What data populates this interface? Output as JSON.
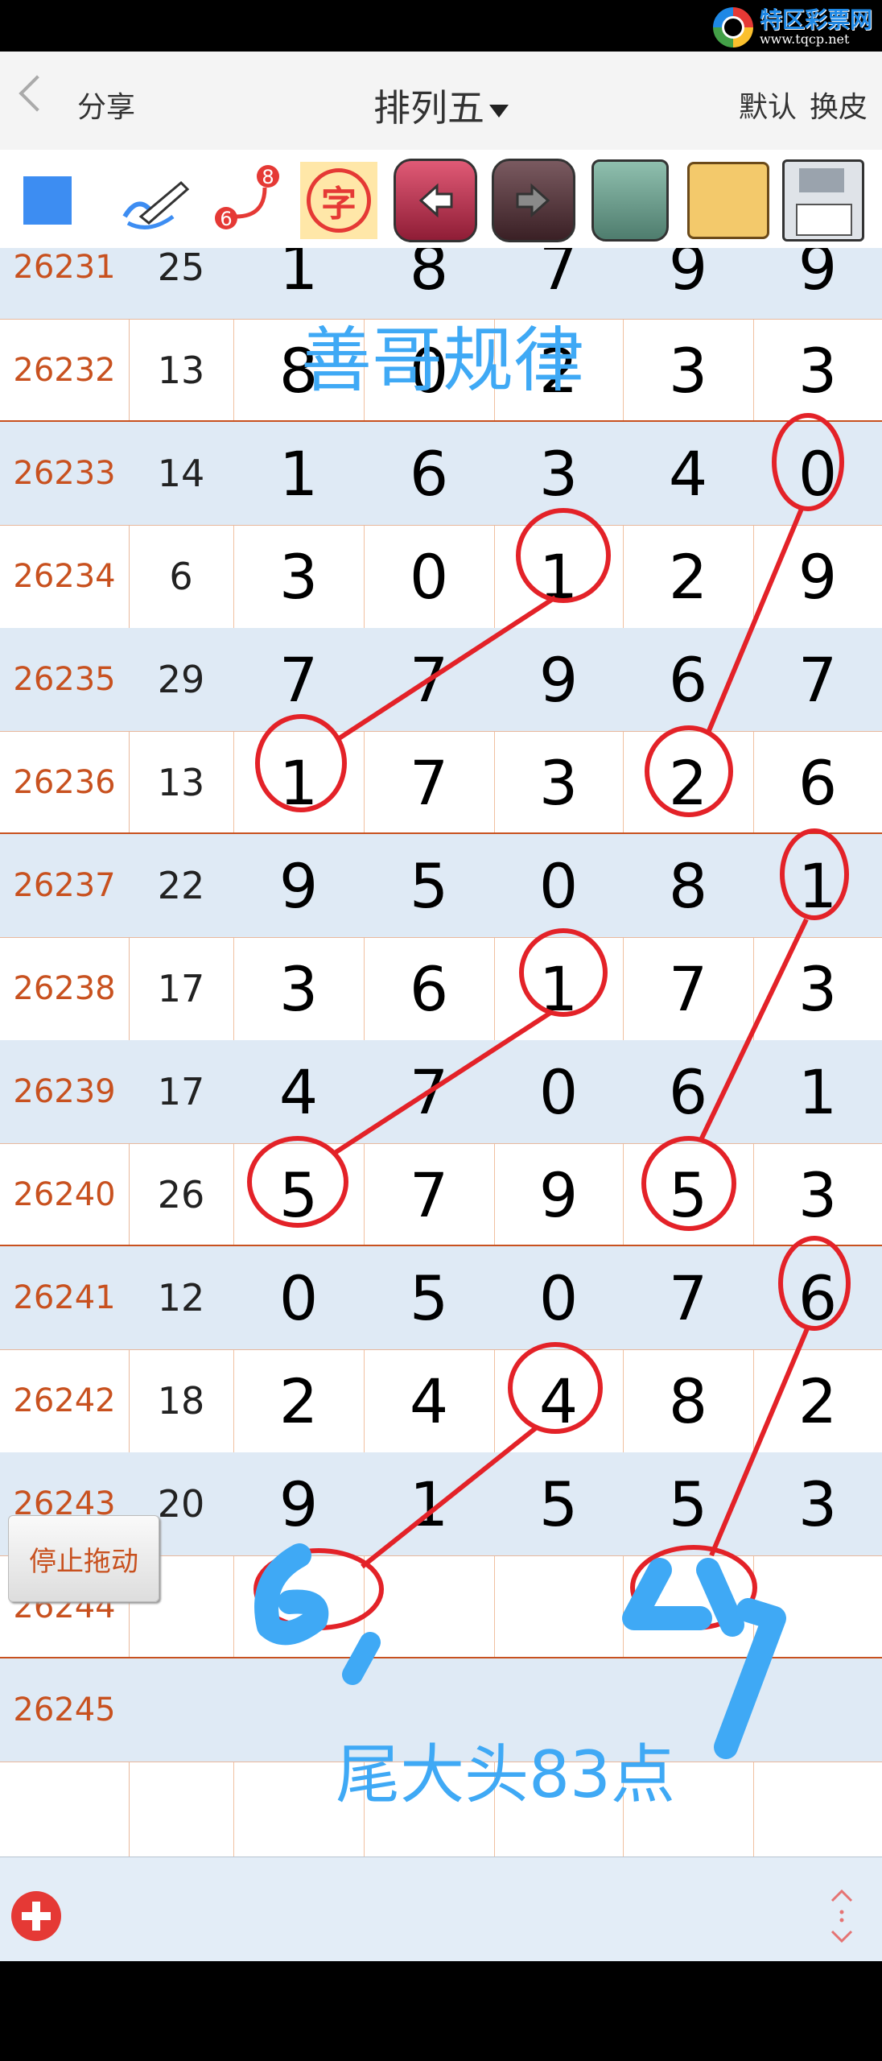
{
  "watermark": {
    "title": "特区彩票网",
    "url": "www.tqcp.net"
  },
  "header": {
    "share_label": "分享",
    "title": "排列五",
    "default_label": "默认",
    "skin_label": "换皮"
  },
  "toolbar": {
    "items": [
      {
        "name": "color-square-icon"
      },
      {
        "name": "pen-icon"
      },
      {
        "name": "curve-6-8-icon",
        "text_a": "6",
        "text_b": "8"
      },
      {
        "name": "zi-text-icon",
        "text": "字"
      },
      {
        "name": "undo-arrow-icon"
      },
      {
        "name": "redo-arrow-icon"
      },
      {
        "name": "trash-icon"
      },
      {
        "name": "photos-icon"
      },
      {
        "name": "save-disk-icon"
      }
    ]
  },
  "table": {
    "rows": [
      {
        "issue": "26231",
        "sum": "25",
        "digits": [
          "1",
          "8",
          "7",
          "9",
          "9"
        ]
      },
      {
        "issue": "26232",
        "sum": "13",
        "digits": [
          "8",
          "0",
          "2",
          "3",
          "3"
        ]
      },
      {
        "issue": "26233",
        "sum": "14",
        "digits": [
          "1",
          "6",
          "3",
          "4",
          "0"
        ]
      },
      {
        "issue": "26234",
        "sum": "6",
        "digits": [
          "3",
          "0",
          "1",
          "2",
          "9"
        ]
      },
      {
        "issue": "26235",
        "sum": "29",
        "digits": [
          "7",
          "7",
          "9",
          "6",
          "7"
        ]
      },
      {
        "issue": "26236",
        "sum": "13",
        "digits": [
          "1",
          "7",
          "3",
          "2",
          "6"
        ]
      },
      {
        "issue": "26237",
        "sum": "22",
        "digits": [
          "9",
          "5",
          "0",
          "8",
          "1"
        ]
      },
      {
        "issue": "26238",
        "sum": "17",
        "digits": [
          "3",
          "6",
          "1",
          "7",
          "3"
        ]
      },
      {
        "issue": "26239",
        "sum": "17",
        "digits": [
          "4",
          "7",
          "0",
          "6",
          "1"
        ]
      },
      {
        "issue": "26240",
        "sum": "26",
        "digits": [
          "5",
          "7",
          "9",
          "5",
          "3"
        ]
      },
      {
        "issue": "26241",
        "sum": "12",
        "digits": [
          "0",
          "5",
          "0",
          "7",
          "6"
        ]
      },
      {
        "issue": "26242",
        "sum": "18",
        "digits": [
          "2",
          "4",
          "4",
          "8",
          "2"
        ]
      },
      {
        "issue": "26243",
        "sum": "20",
        "digits": [
          "9",
          "1",
          "5",
          "5",
          "3"
        ]
      },
      {
        "issue": "26244",
        "sum": "",
        "digits": [
          "",
          "",
          "",
          "",
          ""
        ]
      },
      {
        "issue": "26245",
        "sum": "",
        "digits": [
          "",
          "",
          "",
          "",
          ""
        ]
      },
      {
        "issue": "",
        "sum": "",
        "digits": [
          "",
          "",
          "",
          "",
          ""
        ]
      }
    ]
  },
  "annotations": {
    "top_text": "善哥规律",
    "bottom_text": "尾大头83点",
    "handwritten_digits": [
      "6",
      "4"
    ],
    "colors": {
      "red": "#e32228",
      "blue": "#3fa9f5"
    }
  },
  "stop_drag_label": "停止拖动",
  "colors": {
    "issue_text": "#c8511f",
    "row_shade": "#dfeaf5",
    "group_divider": "#c8511f"
  }
}
